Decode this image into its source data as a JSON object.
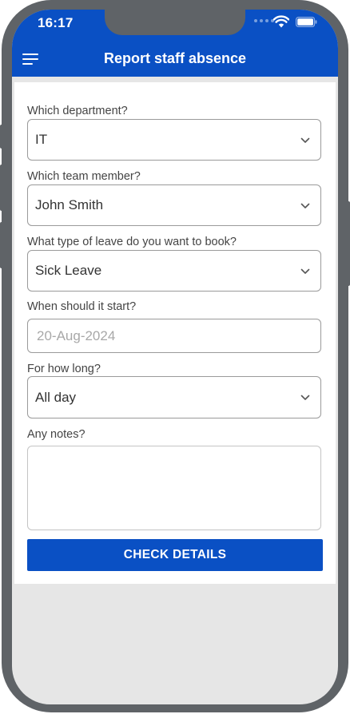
{
  "status_bar": {
    "time": "16:17",
    "signal_icon": "signal-dots-icon",
    "wifi_icon": "wifi-icon",
    "battery_icon": "battery-icon"
  },
  "appbar": {
    "title": "Report staff absence",
    "menu_icon": "hamburger-menu-icon"
  },
  "form": {
    "department": {
      "label": "Which department?",
      "value": "IT"
    },
    "team_member": {
      "label": "Which team member?",
      "value": "John Smith"
    },
    "leave_type": {
      "label": "What type of leave do you want to book?",
      "value": "Sick Leave"
    },
    "start_date": {
      "label": "When should it start?",
      "value": "",
      "placeholder": "20-Aug-2024"
    },
    "duration": {
      "label": "For how long?",
      "value": "All day"
    },
    "notes": {
      "label": "Any notes?",
      "value": ""
    },
    "submit_label": "CHECK DETAILS"
  },
  "colors": {
    "brand_blue": "#0a50c4",
    "frame_gray": "#5f6367",
    "screen_bg": "#e6e6e6",
    "label_text": "#444444",
    "field_border": "#9a9a9a",
    "placeholder_text": "#a8a8a8"
  }
}
